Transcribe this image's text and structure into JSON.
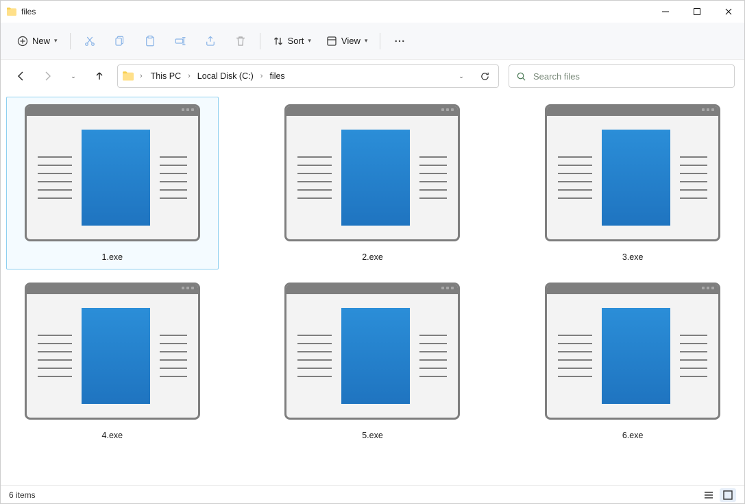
{
  "window": {
    "title": "files"
  },
  "toolbar": {
    "new_label": "New",
    "sort_label": "Sort",
    "view_label": "View"
  },
  "breadcrumbs": {
    "items": [
      "This PC",
      "Local Disk (C:)",
      "files"
    ]
  },
  "search": {
    "placeholder": "Search files"
  },
  "files": {
    "items": [
      {
        "name": "1.exe",
        "selected": true
      },
      {
        "name": "2.exe",
        "selected": false
      },
      {
        "name": "3.exe",
        "selected": false
      },
      {
        "name": "4.exe",
        "selected": false
      },
      {
        "name": "5.exe",
        "selected": false
      },
      {
        "name": "6.exe",
        "selected": false
      }
    ]
  },
  "status": {
    "count_label": "6 items"
  }
}
